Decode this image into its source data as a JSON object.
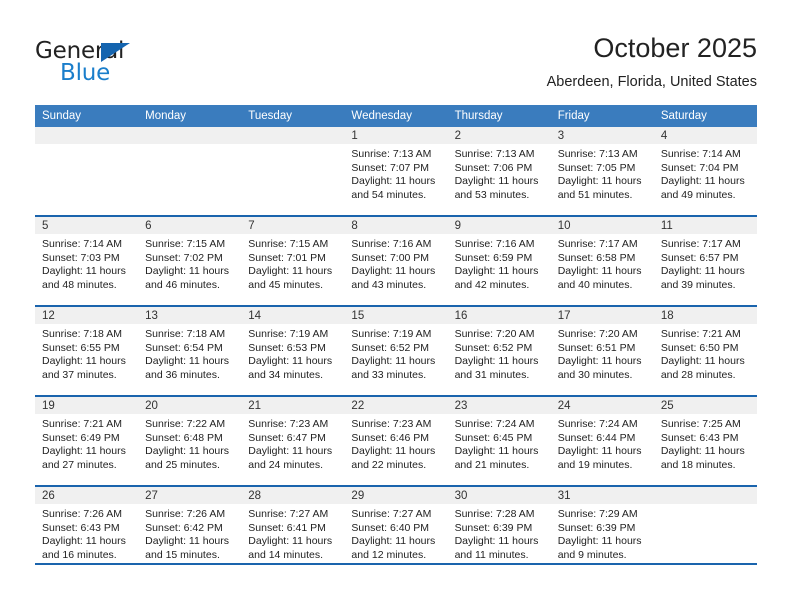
{
  "brand": {
    "name_part1": "General",
    "name_part2": "Blue",
    "accent_color": "#1a7ecb",
    "triangle_color": "#1464af"
  },
  "header": {
    "title": "October 2025",
    "subtitle": "Aberdeen, Florida, United States",
    "header_bg": "#3a7cbe",
    "row_divider_color": "#1a64ad"
  },
  "weekdays": [
    "Sunday",
    "Monday",
    "Tuesday",
    "Wednesday",
    "Thursday",
    "Friday",
    "Saturday"
  ],
  "weeks": [
    [
      {
        "day": "",
        "sunrise": "",
        "sunset": "",
        "daylight": ""
      },
      {
        "day": "",
        "sunrise": "",
        "sunset": "",
        "daylight": ""
      },
      {
        "day": "",
        "sunrise": "",
        "sunset": "",
        "daylight": ""
      },
      {
        "day": "1",
        "sunrise": "Sunrise: 7:13 AM",
        "sunset": "Sunset: 7:07 PM",
        "daylight": "Daylight: 11 hours and 54 minutes."
      },
      {
        "day": "2",
        "sunrise": "Sunrise: 7:13 AM",
        "sunset": "Sunset: 7:06 PM",
        "daylight": "Daylight: 11 hours and 53 minutes."
      },
      {
        "day": "3",
        "sunrise": "Sunrise: 7:13 AM",
        "sunset": "Sunset: 7:05 PM",
        "daylight": "Daylight: 11 hours and 51 minutes."
      },
      {
        "day": "4",
        "sunrise": "Sunrise: 7:14 AM",
        "sunset": "Sunset: 7:04 PM",
        "daylight": "Daylight: 11 hours and 49 minutes."
      }
    ],
    [
      {
        "day": "5",
        "sunrise": "Sunrise: 7:14 AM",
        "sunset": "Sunset: 7:03 PM",
        "daylight": "Daylight: 11 hours and 48 minutes."
      },
      {
        "day": "6",
        "sunrise": "Sunrise: 7:15 AM",
        "sunset": "Sunset: 7:02 PM",
        "daylight": "Daylight: 11 hours and 46 minutes."
      },
      {
        "day": "7",
        "sunrise": "Sunrise: 7:15 AM",
        "sunset": "Sunset: 7:01 PM",
        "daylight": "Daylight: 11 hours and 45 minutes."
      },
      {
        "day": "8",
        "sunrise": "Sunrise: 7:16 AM",
        "sunset": "Sunset: 7:00 PM",
        "daylight": "Daylight: 11 hours and 43 minutes."
      },
      {
        "day": "9",
        "sunrise": "Sunrise: 7:16 AM",
        "sunset": "Sunset: 6:59 PM",
        "daylight": "Daylight: 11 hours and 42 minutes."
      },
      {
        "day": "10",
        "sunrise": "Sunrise: 7:17 AM",
        "sunset": "Sunset: 6:58 PM",
        "daylight": "Daylight: 11 hours and 40 minutes."
      },
      {
        "day": "11",
        "sunrise": "Sunrise: 7:17 AM",
        "sunset": "Sunset: 6:57 PM",
        "daylight": "Daylight: 11 hours and 39 minutes."
      }
    ],
    [
      {
        "day": "12",
        "sunrise": "Sunrise: 7:18 AM",
        "sunset": "Sunset: 6:55 PM",
        "daylight": "Daylight: 11 hours and 37 minutes."
      },
      {
        "day": "13",
        "sunrise": "Sunrise: 7:18 AM",
        "sunset": "Sunset: 6:54 PM",
        "daylight": "Daylight: 11 hours and 36 minutes."
      },
      {
        "day": "14",
        "sunrise": "Sunrise: 7:19 AM",
        "sunset": "Sunset: 6:53 PM",
        "daylight": "Daylight: 11 hours and 34 minutes."
      },
      {
        "day": "15",
        "sunrise": "Sunrise: 7:19 AM",
        "sunset": "Sunset: 6:52 PM",
        "daylight": "Daylight: 11 hours and 33 minutes."
      },
      {
        "day": "16",
        "sunrise": "Sunrise: 7:20 AM",
        "sunset": "Sunset: 6:52 PM",
        "daylight": "Daylight: 11 hours and 31 minutes."
      },
      {
        "day": "17",
        "sunrise": "Sunrise: 7:20 AM",
        "sunset": "Sunset: 6:51 PM",
        "daylight": "Daylight: 11 hours and 30 minutes."
      },
      {
        "day": "18",
        "sunrise": "Sunrise: 7:21 AM",
        "sunset": "Sunset: 6:50 PM",
        "daylight": "Daylight: 11 hours and 28 minutes."
      }
    ],
    [
      {
        "day": "19",
        "sunrise": "Sunrise: 7:21 AM",
        "sunset": "Sunset: 6:49 PM",
        "daylight": "Daylight: 11 hours and 27 minutes."
      },
      {
        "day": "20",
        "sunrise": "Sunrise: 7:22 AM",
        "sunset": "Sunset: 6:48 PM",
        "daylight": "Daylight: 11 hours and 25 minutes."
      },
      {
        "day": "21",
        "sunrise": "Sunrise: 7:23 AM",
        "sunset": "Sunset: 6:47 PM",
        "daylight": "Daylight: 11 hours and 24 minutes."
      },
      {
        "day": "22",
        "sunrise": "Sunrise: 7:23 AM",
        "sunset": "Sunset: 6:46 PM",
        "daylight": "Daylight: 11 hours and 22 minutes."
      },
      {
        "day": "23",
        "sunrise": "Sunrise: 7:24 AM",
        "sunset": "Sunset: 6:45 PM",
        "daylight": "Daylight: 11 hours and 21 minutes."
      },
      {
        "day": "24",
        "sunrise": "Sunrise: 7:24 AM",
        "sunset": "Sunset: 6:44 PM",
        "daylight": "Daylight: 11 hours and 19 minutes."
      },
      {
        "day": "25",
        "sunrise": "Sunrise: 7:25 AM",
        "sunset": "Sunset: 6:43 PM",
        "daylight": "Daylight: 11 hours and 18 minutes."
      }
    ],
    [
      {
        "day": "26",
        "sunrise": "Sunrise: 7:26 AM",
        "sunset": "Sunset: 6:43 PM",
        "daylight": "Daylight: 11 hours and 16 minutes."
      },
      {
        "day": "27",
        "sunrise": "Sunrise: 7:26 AM",
        "sunset": "Sunset: 6:42 PM",
        "daylight": "Daylight: 11 hours and 15 minutes."
      },
      {
        "day": "28",
        "sunrise": "Sunrise: 7:27 AM",
        "sunset": "Sunset: 6:41 PM",
        "daylight": "Daylight: 11 hours and 14 minutes."
      },
      {
        "day": "29",
        "sunrise": "Sunrise: 7:27 AM",
        "sunset": "Sunset: 6:40 PM",
        "daylight": "Daylight: 11 hours and 12 minutes."
      },
      {
        "day": "30",
        "sunrise": "Sunrise: 7:28 AM",
        "sunset": "Sunset: 6:39 PM",
        "daylight": "Daylight: 11 hours and 11 minutes."
      },
      {
        "day": "31",
        "sunrise": "Sunrise: 7:29 AM",
        "sunset": "Sunset: 6:39 PM",
        "daylight": "Daylight: 11 hours and 9 minutes."
      },
      {
        "day": "",
        "sunrise": "",
        "sunset": "",
        "daylight": ""
      }
    ]
  ]
}
